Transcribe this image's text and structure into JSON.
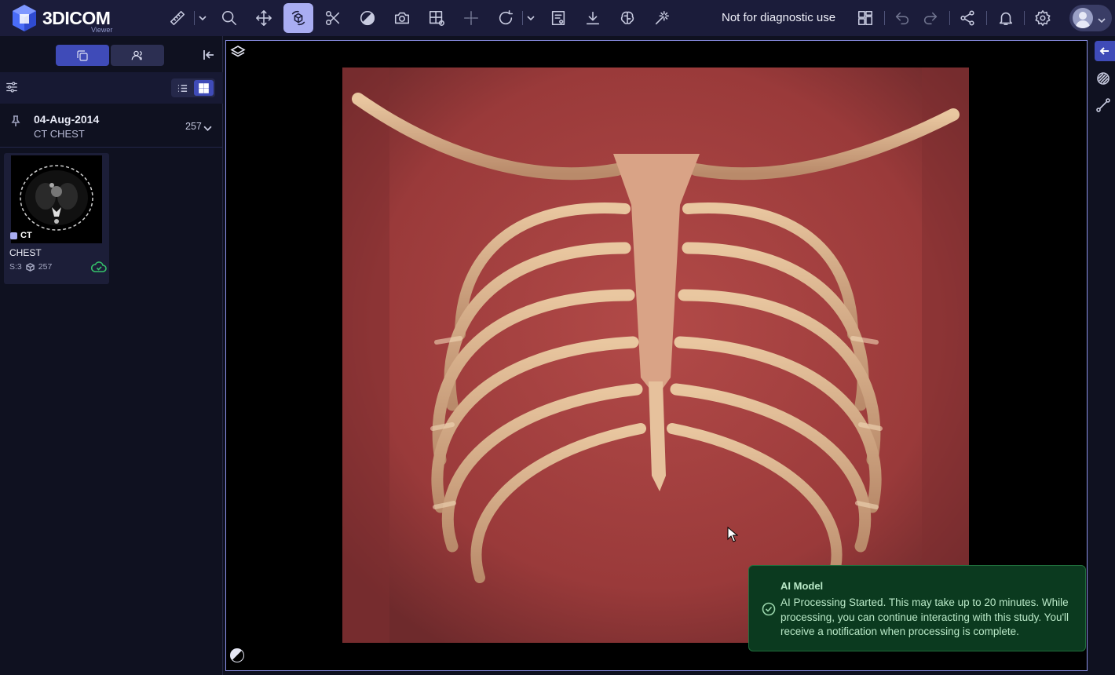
{
  "app": {
    "logo_text": "3DICOM",
    "logo_sub": "Viewer",
    "notice": "Not for diagnostic use"
  },
  "toolbar": {
    "tools": [
      {
        "name": "measure-icon",
        "active": false
      },
      {
        "name": "zoom-icon",
        "active": false
      },
      {
        "name": "pan-icon",
        "active": false
      },
      {
        "name": "rotate-3d-icon",
        "active": true
      },
      {
        "name": "scissors-icon",
        "active": false
      },
      {
        "name": "window-level-icon",
        "active": false
      },
      {
        "name": "camera-icon",
        "active": false
      },
      {
        "name": "layout-settings-icon",
        "active": false
      },
      {
        "name": "crosshair-icon",
        "active": false
      },
      {
        "name": "reset-icon",
        "active": false
      },
      {
        "name": "report-icon",
        "active": false
      },
      {
        "name": "download-icon",
        "active": false
      },
      {
        "name": "brain-ai-icon",
        "active": false
      },
      {
        "name": "magic-wand-icon",
        "active": false
      }
    ],
    "right": [
      "layout-grid-icon",
      "undo-icon",
      "redo-icon",
      "share-icon",
      "bell-icon",
      "gear-icon",
      "avatar"
    ]
  },
  "sidebar": {
    "tabs": [
      {
        "name": "series-tab",
        "icon": "copy-icon",
        "active": true
      },
      {
        "name": "patients-tab",
        "icon": "users-icon",
        "active": false
      }
    ],
    "view_mode": "grid",
    "study": {
      "date": "04-Aug-2014",
      "description": "CT CHEST",
      "count": "257"
    },
    "series": [
      {
        "modality": "CT",
        "name": "CHEST",
        "series_label": "S:3",
        "images": "257",
        "cloud_status": "synced"
      }
    ]
  },
  "toast": {
    "title": "AI Model",
    "message": "AI Processing Started. This may take up to 20 minutes. While processing, you can continue interacting with this study. You'll receive a notification when processing is complete.",
    "color": "#0b3a1f"
  },
  "colors": {
    "topbar": "#1b1c3a",
    "accent": "#3f4bb8",
    "active_tool": "#a9adf2",
    "viewport_border": "#8c91e8",
    "success": "#35c26a"
  }
}
